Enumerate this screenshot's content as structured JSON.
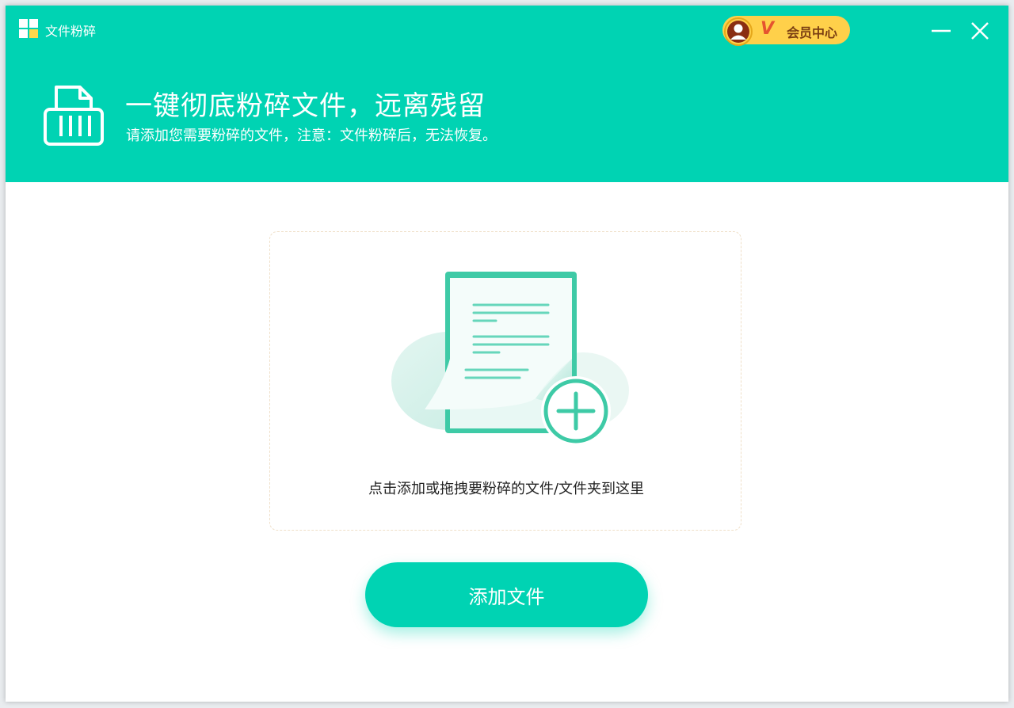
{
  "app": {
    "title": "文件粉碎",
    "logo_icon": "windows-grid-icon"
  },
  "vip": {
    "badge": "V",
    "label": "会员中心",
    "avatar_icon": "user-avatar-icon"
  },
  "window_controls": {
    "minimize_icon": "minimize-icon",
    "close_icon": "close-icon"
  },
  "hero": {
    "title": "一键彻底粉碎文件，远离残留",
    "subtitle": "请添加您需要粉碎的文件，注意：文件粉碎后，无法恢复。",
    "icon": "shredder-icon"
  },
  "dropzone": {
    "hint": "点击添加或拖拽要粉碎的文件/文件夹到这里",
    "illustration_icon": "document-add-icon"
  },
  "add_button": {
    "label": "添加文件"
  },
  "colors": {
    "brand": "#00d3b3",
    "vip_gold": "#ffd04a",
    "vip_text": "#7a3e12",
    "vip_v": "#e5532f"
  }
}
